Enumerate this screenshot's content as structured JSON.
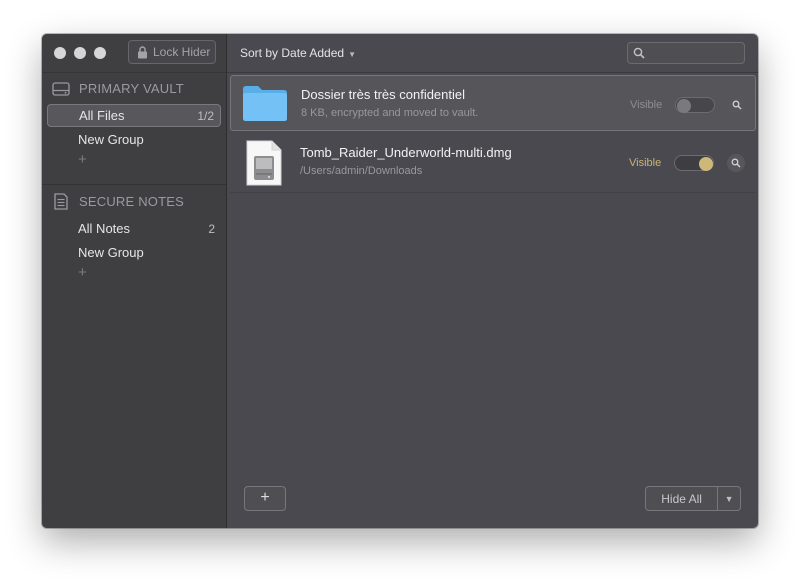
{
  "window": {
    "lock_button": {
      "label": "Lock Hider",
      "icon": "lock-icon"
    },
    "sort_menu": {
      "label": "Sort by Date Added",
      "icon": "caret-down-icon"
    },
    "search": {
      "placeholder": "",
      "icon": "search-icon"
    }
  },
  "sidebar": {
    "sections": [
      {
        "title": "PRIMARY VAULT",
        "icon": "hard-drive-icon",
        "items": [
          {
            "label": "All Files",
            "count": "1/2",
            "selected": true
          },
          {
            "label": "New Group",
            "count": "",
            "selected": false
          }
        ],
        "add_label": "+"
      },
      {
        "title": "SECURE NOTES",
        "icon": "note-icon",
        "items": [
          {
            "label": "All Notes",
            "count": "2",
            "selected": false
          },
          {
            "label": "New Group",
            "count": "",
            "selected": false
          }
        ],
        "add_label": "+"
      }
    ]
  },
  "files": [
    {
      "name": "Dossier très très confidentiel",
      "detail": "8 KB, encrypted and moved to vault.",
      "visibility_label": "Visible",
      "visible": false,
      "icon": "folder-icon",
      "selected": true
    },
    {
      "name": "Tomb_Raider_Underworld-multi.dmg",
      "detail": "/Users/admin/Downloads",
      "visibility_label": "Visible",
      "visible": true,
      "icon": "disk-image-icon",
      "selected": false
    }
  ],
  "footer": {
    "add_label": "+",
    "hide_all_label": "Hide All",
    "dropdown_icon": "chevron-down-icon"
  },
  "colors": {
    "toggle_on_knob": "#cdb879",
    "toggle_on_label": "#c9b574",
    "toggle_off_label": "#8e8e93",
    "folder_blue": "#6bbcf2"
  }
}
